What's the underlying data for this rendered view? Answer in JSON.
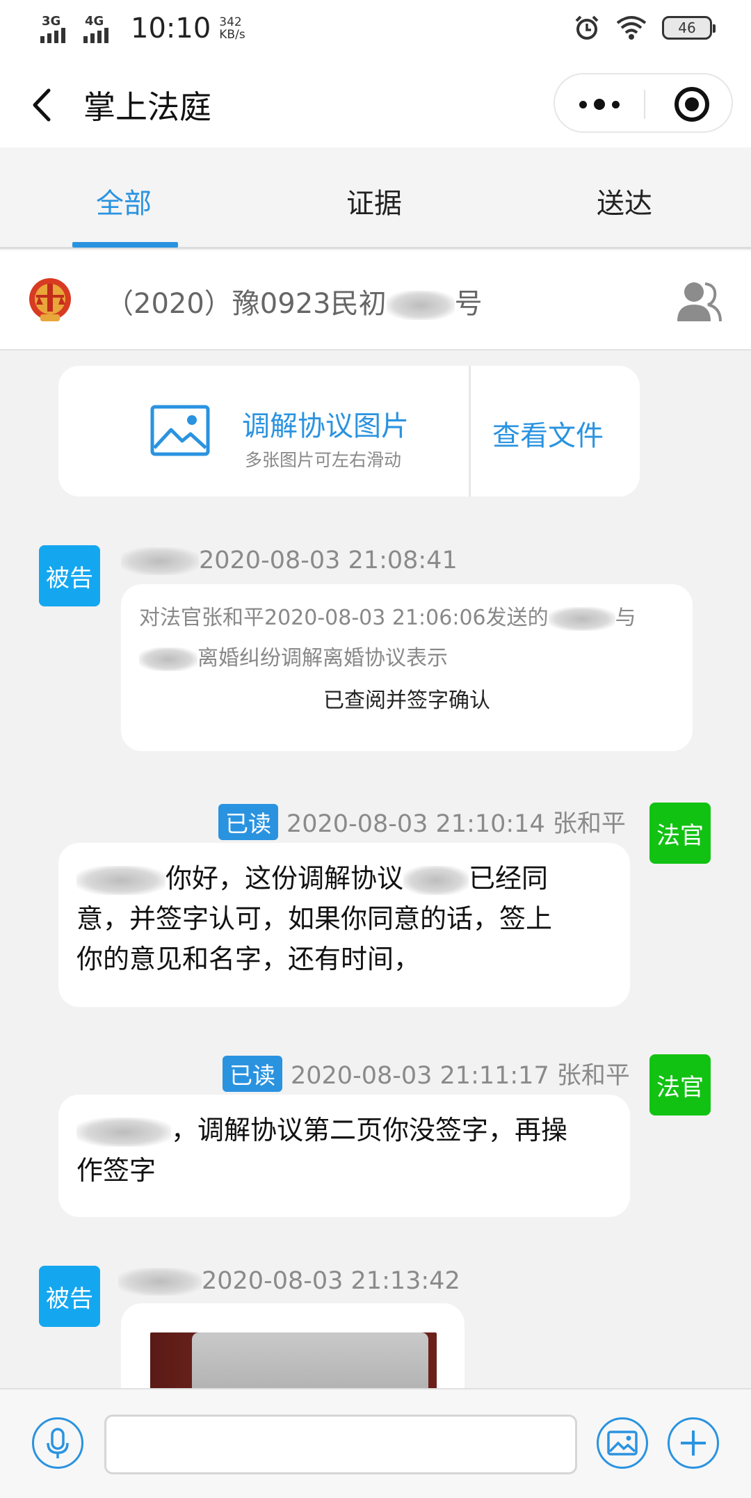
{
  "status_bar": {
    "network1": "3G",
    "network2": "4G",
    "time": "10:10",
    "speed_value": "342",
    "speed_unit": "KB/s",
    "battery": "46"
  },
  "header": {
    "title": "掌上法庭"
  },
  "tabs": [
    {
      "label": "全部",
      "active": true
    },
    {
      "label": "证据",
      "active": false
    },
    {
      "label": "送达",
      "active": false
    }
  ],
  "case": {
    "title_prefix": "（2020）豫0923民初",
    "title_suffix": "号"
  },
  "file_card": {
    "name": "调解协议图片",
    "hint": "多张图片可左右滑动",
    "view_label": "查看文件"
  },
  "messages": [
    {
      "role": "被告",
      "time": "2020-08-03 21:08:41",
      "ack_line1_prefix": "对法官张和平2020-08-03 21:06:06发送的",
      "ack_line1_suffix": "与",
      "ack_line2_suffix": "离婚纠纷调解离婚协议表示",
      "ack_confirm": "已查阅并签字确认"
    },
    {
      "role": "法官",
      "read": "已读",
      "time_sender": "2020-08-03 21:10:14 张和平",
      "line1_a": "你好，这份调解协议",
      "line1_b": "已经同",
      "line2": "意，并签字认可，如果你同意的话，签上",
      "line3": "你的意见和名字，还有时间，"
    },
    {
      "role": "法官",
      "read": "已读",
      "time_sender": "2020-08-03 21:11:17 张和平",
      "line1": "，调解协议第二页你没签字，再操",
      "line2": "作签字"
    },
    {
      "role": "被告",
      "time": "2020-08-03 21:13:42"
    }
  ],
  "colors": {
    "accent": "#2a93e0",
    "defendant_badge": "#14a7f0",
    "judge_badge": "#12c213"
  }
}
